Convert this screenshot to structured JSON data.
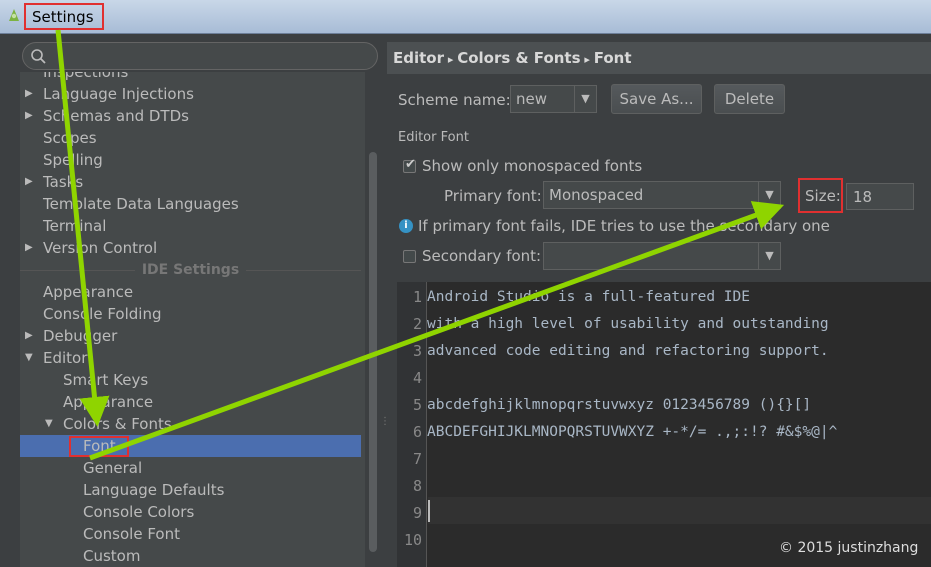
{
  "window": {
    "title": "Settings",
    "app_icon": "android-studio-icon"
  },
  "search": {
    "placeholder": "",
    "value": ""
  },
  "tree": {
    "items": [
      {
        "label": "Inspections",
        "expandable": false
      },
      {
        "label": "Language Injections",
        "expandable": true
      },
      {
        "label": "Schemas and DTDs",
        "expandable": true
      },
      {
        "label": "Scopes",
        "expandable": false
      },
      {
        "label": "Spelling",
        "expandable": false
      },
      {
        "label": "Tasks",
        "expandable": true
      },
      {
        "label": "Template Data Languages",
        "expandable": false
      },
      {
        "label": "Terminal",
        "expandable": false
      },
      {
        "label": "Version Control",
        "expandable": true
      }
    ],
    "section_header": "IDE Settings",
    "ide_items": [
      {
        "label": "Appearance"
      },
      {
        "label": "Console Folding"
      },
      {
        "label": "Debugger"
      },
      {
        "label": "Editor"
      },
      {
        "label": "Smart Keys"
      },
      {
        "label": "Appearance"
      },
      {
        "label": "Colors & Fonts"
      },
      {
        "label": "Font"
      },
      {
        "label": "General"
      },
      {
        "label": "Language Defaults"
      },
      {
        "label": "Console Colors"
      },
      {
        "label": "Console Font"
      },
      {
        "label": "Custom"
      }
    ]
  },
  "breadcrumb": {
    "parts": [
      "Editor",
      "Colors & Fonts",
      "Font"
    ]
  },
  "scheme": {
    "label": "Scheme name:",
    "value": "new",
    "save_as": "Save As...",
    "delete": "Delete"
  },
  "editor_font": {
    "group_title": "Editor Font",
    "monospaced_label": "Show only monospaced fonts",
    "monospaced_checked": true,
    "primary_label": "Primary font:",
    "primary_value": "Monospaced",
    "size_label": "Size:",
    "size_value": "18",
    "info_text": "If primary font fails, IDE tries to use the secondary one",
    "secondary_label": "Secondary font:",
    "secondary_value": "",
    "secondary_checked": false
  },
  "preview": {
    "lines": [
      {
        "num": "1",
        "text": "Android Studio is a full-featured IDE"
      },
      {
        "num": "2",
        "text": "with a high level of usability and outstanding"
      },
      {
        "num": "3",
        "text": "advanced code editing and refactoring support."
      },
      {
        "num": "4",
        "text": ""
      },
      {
        "num": "5",
        "text": "abcdefghijklmnopqrstuvwxyz 0123456789 (){}[]"
      },
      {
        "num": "6",
        "text": "ABCDEFGHIJKLMNOPQRSTUVWXYZ +-*/= .,;:!? #&$%@|^"
      },
      {
        "num": "7",
        "text": ""
      },
      {
        "num": "8",
        "text": ""
      },
      {
        "num": "9",
        "text": ""
      },
      {
        "num": "10",
        "text": ""
      }
    ]
  },
  "watermark": "© 2015 justinzhang",
  "colors": {
    "annotation_arrow": "#8fd400",
    "highlight_box": "#e03030",
    "selection": "#4b6eaf"
  }
}
